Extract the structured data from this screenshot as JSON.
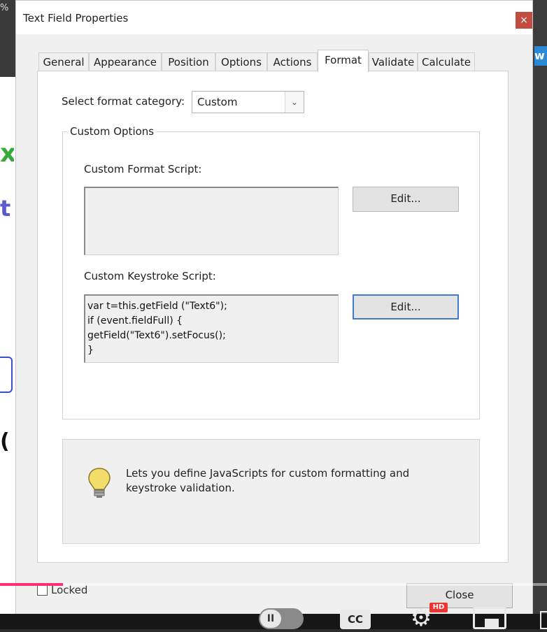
{
  "background_app": {
    "zoom_fragment": "%",
    "right_button_fragment": "w"
  },
  "dialog": {
    "title": "Text Field Properties",
    "close_glyph": "×",
    "tabs": [
      {
        "label": "General"
      },
      {
        "label": "Appearance"
      },
      {
        "label": "Position"
      },
      {
        "label": "Options"
      },
      {
        "label": "Actions"
      },
      {
        "label": "Format",
        "active": true
      },
      {
        "label": "Validate"
      },
      {
        "label": "Calculate"
      }
    ],
    "format": {
      "category_label": "Select format category:",
      "category_value": "Custom",
      "group_title": "Custom Options",
      "format_script_label": "Custom Format Script:",
      "format_script_value": "",
      "format_edit_button": "Edit...",
      "keystroke_script_label": "Custom Keystroke Script:",
      "keystroke_script_value": "var t=this.getField (\"Text6\");\nif (event.fieldFull) {\ngetField(\"Text6\").setFocus();\n}",
      "keystroke_edit_button": "Edit...",
      "info_text": "Lets you define JavaScripts for custom formatting and keystroke validation.",
      "info_icon": "lightbulb-icon"
    },
    "locked": {
      "label": "Locked",
      "checked": false
    },
    "close_button": "Close"
  },
  "video_player": {
    "progress": 0.115,
    "progress_color": "#ff2f6f",
    "cc_label": "CC",
    "hd_badge": "HD",
    "pause_glyph": "II"
  }
}
